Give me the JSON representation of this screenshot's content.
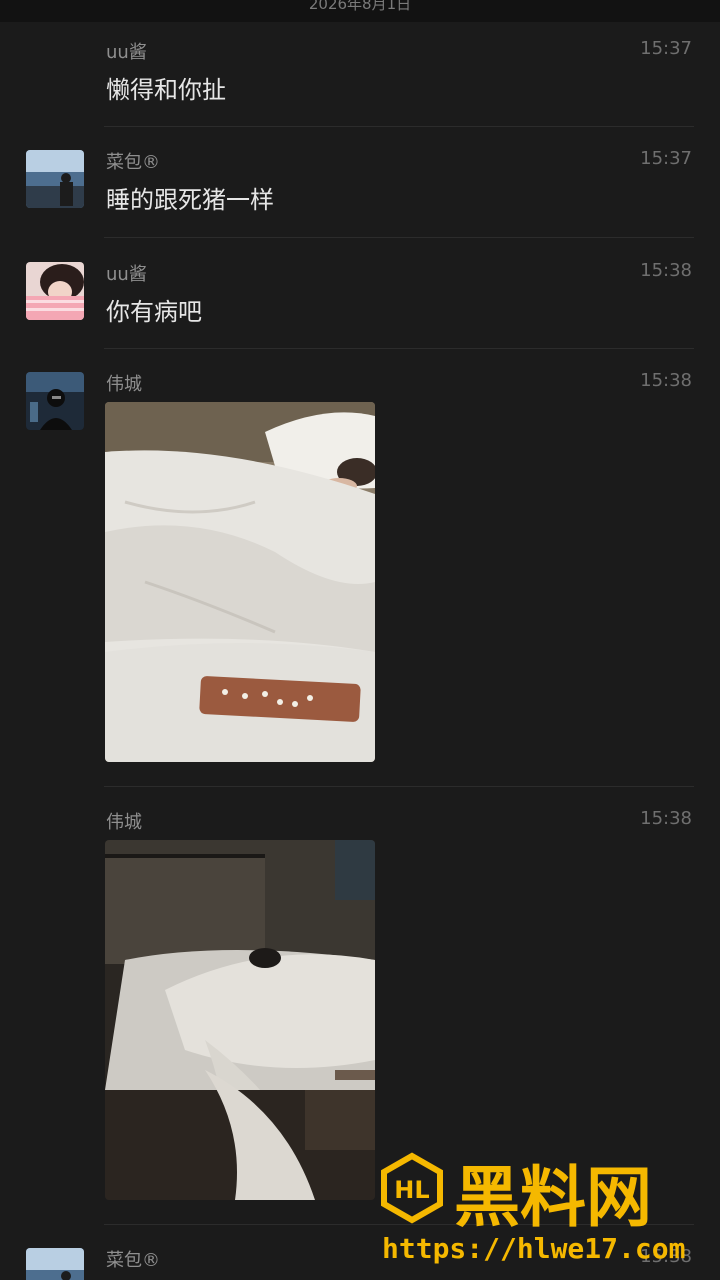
{
  "header": {
    "date": "2026年8月1日"
  },
  "messages": [
    {
      "sender": "uu酱",
      "time": "15:37",
      "text": "懒得和你扯"
    },
    {
      "sender": "菜包®",
      "time": "15:37",
      "text": "睡的跟死猪一样"
    },
    {
      "sender": "uu酱",
      "time": "15:38",
      "text": "你有病吧"
    },
    {
      "sender": "伟城",
      "time": "15:38",
      "image": "photo-person-sleeping-in-bed"
    },
    {
      "sender": "伟城",
      "time": "15:38",
      "image": "photo-dark-hotel-room-bed"
    },
    {
      "sender": "菜包®",
      "time": "15:38"
    }
  ],
  "watermark": {
    "logo_text": "HL",
    "brand_text": "黑料网",
    "url": "https://hlwe17.com"
  },
  "colors": {
    "background": "#1b1b1b",
    "text_primary": "#e6e6e6",
    "text_secondary": "#8f8f8f",
    "watermark": "#f5b800"
  }
}
